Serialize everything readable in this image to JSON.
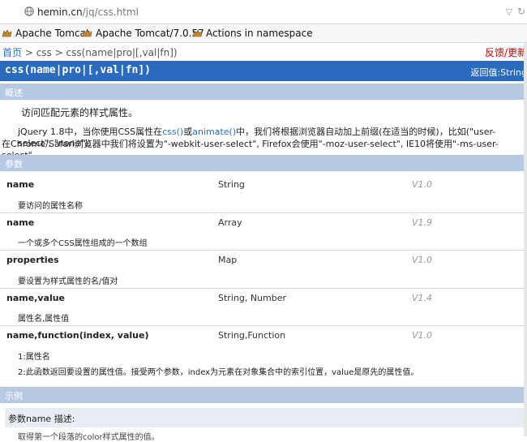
{
  "browser": {
    "url_host": "hemin.cn",
    "url_path": "/jq/css.html"
  },
  "bookmarks": [
    {
      "label": "Apache Tomcat"
    },
    {
      "label": "Apache Tomcat/7.0.57"
    },
    {
      "label": "Actions in namespace"
    }
  ],
  "breadcrumb": {
    "home": "首页",
    "sep1": " > ",
    "cat": "css",
    "sep2": " > ",
    "current": "css(name|pro|[,val|fn])",
    "feedback": "反馈/更新"
  },
  "title": {
    "signature": "css(name|pro|[,val|fn])",
    "returns": "返回值:String"
  },
  "overview": {
    "heading": "概述",
    "summary": "访问匹配元素的样式属性。",
    "line1_a": "jQuery 1.8中，当你使用CSS属性在",
    "link_css": "css()",
    "line1_or": "或",
    "link_animate": "animate()",
    "line1_b": "中，我们将根据浏览器自动加上前缀(在适当的时候)，比如(\"user-select\", \"none\");",
    "line2": "在Chrome/Safari浏览器中我们将设置为\"-webkit-user-select\", Firefox会使用\"-moz-user-select\", IE10将使用\"-ms-user-select\"."
  },
  "params": {
    "heading": "参数",
    "rows": [
      {
        "name": "name",
        "type": "String",
        "version": "V1.0",
        "desc": "要访问的属性名称"
      },
      {
        "name": "name",
        "type": "Array",
        "version": "V1.9",
        "desc": "一个或多个CSS属性组成的一个数组"
      },
      {
        "name": "properties",
        "type": "Map",
        "version": "V1.0",
        "desc": "要设置为样式属性的名/值对"
      },
      {
        "name": "name,value",
        "type": "String, Number",
        "version": "V1.4",
        "desc": "属性名,属性值"
      },
      {
        "name": "name,function(index, value)",
        "type": "String,Function",
        "version": "V1.0",
        "desc": "1:属性名"
      }
    ],
    "extra_desc": "2:此函数返回要设置的属性值。接受两个参数，index为元素在对象集合中的索引位置，value是原先的属性值。"
  },
  "examples": {
    "heading": "示例",
    "example_title": "参数name 描述:",
    "cut_text": "取得第一个段落的color样式属性的值。"
  }
}
